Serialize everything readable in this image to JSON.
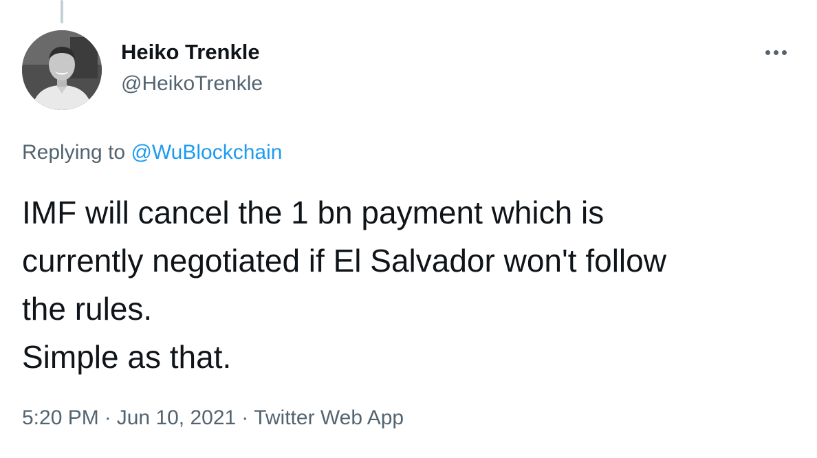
{
  "tweet": {
    "author": {
      "display_name": "Heiko Trenkle",
      "handle": "@HeikoTrenkle",
      "avatar_icon": "profile-photo"
    },
    "menu_icon": "more-horizontal-icon",
    "reply_context": {
      "prefix": "Replying to ",
      "mention": "@WuBlockchain"
    },
    "text_lines": [
      "IMF will cancel the 1 bn payment which is",
      "currently negotiated if El Salvador won't follow",
      "the rules.",
      "Simple as that."
    ],
    "meta": {
      "time": "5:20 PM",
      "separator": "·",
      "date": "Jun 10, 2021",
      "source": "Twitter Web App"
    }
  },
  "colors": {
    "text_primary": "#0f1419",
    "text_secondary": "#536471",
    "link": "#1d9bf0",
    "thread_line": "#c4cfd6"
  }
}
